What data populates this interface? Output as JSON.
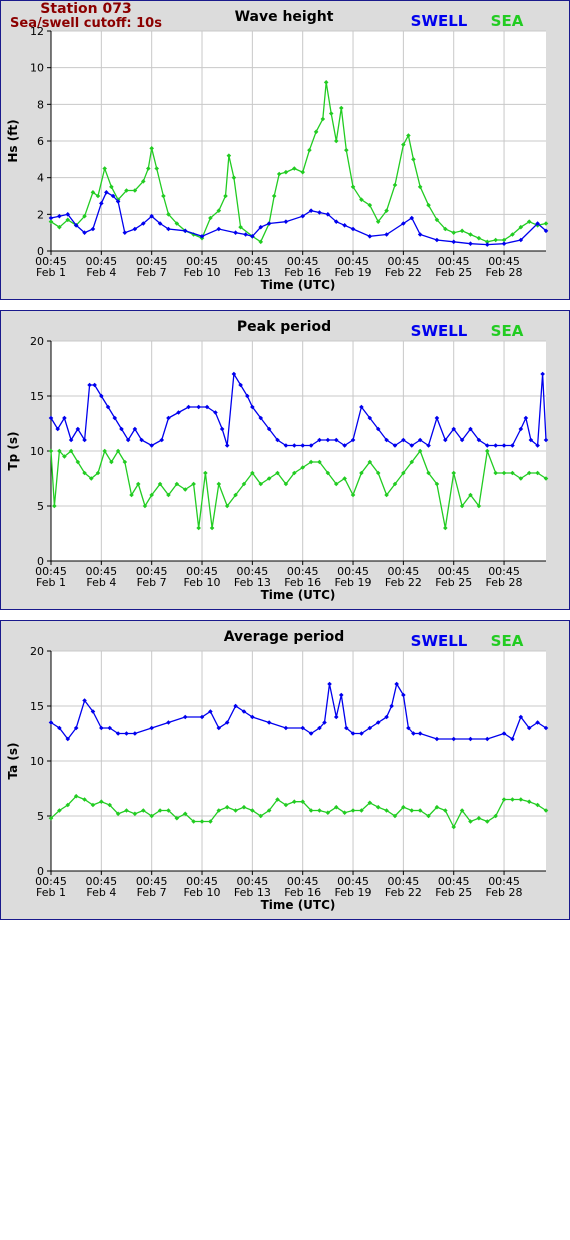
{
  "station": {
    "title": "Station 073",
    "cutoff": "Sea/swell cutoff: 10s"
  },
  "colors": {
    "swell": "#0000ee",
    "sea": "#22cc22",
    "frame": "#1a1a8c",
    "panel_bg": "#dcdcdc",
    "station": "#8b0000"
  },
  "chart_data": [
    {
      "type": "line",
      "title": "Wave height",
      "ylabel": "Hs (ft)",
      "xlabel": "Time (UTC)",
      "ylim": [
        0,
        12
      ],
      "yticks": [
        0,
        2,
        4,
        6,
        8,
        10,
        12
      ],
      "xlim": [
        1,
        30.5
      ],
      "xticks": [
        {
          "x": 1,
          "time": "00:45",
          "date": "Feb 1"
        },
        {
          "x": 4,
          "time": "00:45",
          "date": "Feb 4"
        },
        {
          "x": 7,
          "time": "00:45",
          "date": "Feb 7"
        },
        {
          "x": 10,
          "time": "00:45",
          "date": "Feb 10"
        },
        {
          "x": 13,
          "time": "00:45",
          "date": "Feb 13"
        },
        {
          "x": 16,
          "time": "00:45",
          "date": "Feb 16"
        },
        {
          "x": 19,
          "time": "00:45",
          "date": "Feb 19"
        },
        {
          "x": 22,
          "time": "00:45",
          "date": "Feb 22"
        },
        {
          "x": 25,
          "time": "00:45",
          "date": "Feb 25"
        },
        {
          "x": 28,
          "time": "00:45",
          "date": "Feb 28"
        }
      ],
      "grid": true,
      "legend": "top-right",
      "series": [
        {
          "name": "SWELL",
          "color": "#0000ee",
          "x": [
            1,
            1.5,
            2,
            2.5,
            3,
            3.5,
            4,
            4.3,
            4.7,
            5,
            5.4,
            6,
            6.5,
            7,
            7.5,
            8,
            9,
            10,
            11,
            12,
            12.6,
            13,
            13.5,
            14,
            15,
            16,
            16.5,
            17,
            17.5,
            18,
            18.5,
            19,
            20,
            21,
            22,
            22.5,
            23,
            24,
            25,
            26,
            27,
            28,
            29,
            30,
            30.5
          ],
          "y": [
            1.8,
            1.9,
            2.0,
            1.4,
            1.0,
            1.2,
            2.6,
            3.2,
            3.0,
            2.7,
            1.0,
            1.2,
            1.5,
            1.9,
            1.5,
            1.2,
            1.1,
            0.8,
            1.2,
            1.0,
            0.9,
            0.8,
            1.3,
            1.5,
            1.6,
            1.9,
            2.2,
            2.1,
            2.0,
            1.6,
            1.4,
            1.2,
            0.8,
            0.9,
            1.5,
            1.8,
            0.9,
            0.6,
            0.5,
            0.4,
            0.35,
            0.4,
            0.6,
            1.5,
            1.1
          ]
        },
        {
          "name": "SEA",
          "color": "#22cc22",
          "x": [
            1,
            1.5,
            2,
            2.5,
            3,
            3.5,
            3.8,
            4.2,
            4.6,
            5,
            5.5,
            6,
            6.5,
            6.8,
            7,
            7.3,
            7.7,
            8,
            8.5,
            9,
            9.5,
            10,
            10.5,
            11,
            11.4,
            11.6,
            11.9,
            12.3,
            13,
            13.5,
            14,
            14.3,
            14.6,
            15,
            15.5,
            16,
            16.4,
            16.8,
            17.2,
            17.4,
            17.7,
            18,
            18.3,
            18.6,
            19,
            19.5,
            20,
            20.5,
            21,
            21.5,
            22,
            22.3,
            22.6,
            23,
            23.5,
            24,
            24.5,
            25,
            25.5,
            26,
            26.5,
            27,
            27.5,
            28,
            28.5,
            29,
            29.5,
            30,
            30.5
          ],
          "y": [
            1.6,
            1.3,
            1.7,
            1.4,
            1.9,
            3.2,
            3.0,
            4.5,
            3.5,
            2.8,
            3.3,
            3.3,
            3.8,
            4.5,
            5.6,
            4.5,
            3.0,
            2.0,
            1.5,
            1.1,
            0.9,
            0.7,
            1.8,
            2.2,
            3.0,
            5.2,
            4.0,
            1.3,
            0.8,
            0.5,
            1.5,
            3.0,
            4.2,
            4.3,
            4.5,
            4.3,
            5.5,
            6.5,
            7.2,
            9.2,
            7.5,
            6.0,
            7.8,
            5.5,
            3.5,
            2.8,
            2.5,
            1.6,
            2.2,
            3.6,
            5.8,
            6.3,
            5.0,
            3.5,
            2.5,
            1.7,
            1.2,
            1.0,
            1.1,
            0.9,
            0.7,
            0.5,
            0.6,
            0.6,
            0.9,
            1.3,
            1.6,
            1.4,
            1.5
          ]
        }
      ]
    },
    {
      "type": "line",
      "title": "Peak period",
      "ylabel": "Tp (s)",
      "xlabel": "Time (UTC)",
      "ylim": [
        0,
        20
      ],
      "yticks": [
        0,
        5,
        10,
        15,
        20
      ],
      "xlim": [
        1,
        30.5
      ],
      "xticks": [
        {
          "x": 1,
          "time": "00:45",
          "date": "Feb 1"
        },
        {
          "x": 4,
          "time": "00:45",
          "date": "Feb 4"
        },
        {
          "x": 7,
          "time": "00:45",
          "date": "Feb 7"
        },
        {
          "x": 10,
          "time": "00:45",
          "date": "Feb 10"
        },
        {
          "x": 13,
          "time": "00:45",
          "date": "Feb 13"
        },
        {
          "x": 16,
          "time": "00:45",
          "date": "Feb 16"
        },
        {
          "x": 19,
          "time": "00:45",
          "date": "Feb 19"
        },
        {
          "x": 22,
          "time": "00:45",
          "date": "Feb 22"
        },
        {
          "x": 25,
          "time": "00:45",
          "date": "Feb 25"
        },
        {
          "x": 28,
          "time": "00:45",
          "date": "Feb 28"
        }
      ],
      "grid": true,
      "legend": "top-right",
      "series": [
        {
          "name": "SWELL",
          "color": "#0000ee",
          "x": [
            1,
            1.4,
            1.8,
            2.2,
            2.6,
            3.0,
            3.3,
            3.6,
            4.0,
            4.4,
            4.8,
            5.2,
            5.6,
            6.0,
            6.4,
            7.0,
            7.6,
            8.0,
            8.6,
            9.2,
            9.8,
            10.3,
            10.8,
            11.2,
            11.5,
            11.9,
            12.3,
            12.7,
            13.0,
            13.5,
            14.0,
            14.5,
            15.0,
            15.5,
            16.0,
            16.5,
            17.0,
            17.5,
            18.0,
            18.5,
            19.0,
            19.5,
            20.0,
            20.5,
            21.0,
            21.5,
            22.0,
            22.5,
            23.0,
            23.5,
            24.0,
            24.5,
            25.0,
            25.5,
            26.0,
            26.5,
            27.0,
            27.5,
            28.0,
            28.5,
            29.0,
            29.3,
            29.6,
            30.0,
            30.3,
            30.5
          ],
          "y": [
            13,
            12,
            13,
            11,
            12,
            11,
            16,
            16,
            15,
            14,
            13,
            12,
            11,
            12,
            11,
            10.5,
            11,
            13,
            13.5,
            14,
            14,
            14,
            13.5,
            12,
            10.5,
            17,
            16,
            15,
            14,
            13,
            12,
            11,
            10.5,
            10.5,
            10.5,
            10.5,
            11,
            11,
            11,
            10.5,
            11,
            14,
            13,
            12,
            11,
            10.5,
            11,
            10.5,
            11,
            10.5,
            13,
            11,
            12,
            11,
            12,
            11,
            10.5,
            10.5,
            10.5,
            10.5,
            12,
            13,
            11,
            10.5,
            17,
            11
          ]
        },
        {
          "name": "SEA",
          "color": "#22cc22",
          "x": [
            1,
            1.2,
            1.5,
            1.8,
            2.2,
            2.6,
            3.0,
            3.4,
            3.8,
            4.2,
            4.6,
            5.0,
            5.4,
            5.8,
            6.2,
            6.6,
            7.0,
            7.5,
            8.0,
            8.5,
            9.0,
            9.5,
            9.8,
            10.2,
            10.6,
            11.0,
            11.5,
            12.0,
            12.5,
            13.0,
            13.5,
            14.0,
            14.5,
            15.0,
            15.5,
            16.0,
            16.5,
            17.0,
            17.5,
            18.0,
            18.5,
            19.0,
            19.5,
            20.0,
            20.5,
            21.0,
            21.5,
            22.0,
            22.5,
            23.0,
            23.5,
            24.0,
            24.5,
            25.0,
            25.5,
            26.0,
            26.5,
            27.0,
            27.5,
            28.0,
            28.5,
            29.0,
            29.5,
            30.0,
            30.5
          ],
          "y": [
            10,
            5,
            10,
            9.5,
            10,
            9,
            8,
            7.5,
            8,
            10,
            9,
            10,
            9,
            6,
            7,
            5,
            6,
            7,
            6,
            7,
            6.5,
            7,
            3,
            8,
            3,
            7,
            5,
            6,
            7,
            8,
            7,
            7.5,
            8,
            7,
            8,
            8.5,
            9,
            9,
            8,
            7,
            7.5,
            6,
            8,
            9,
            8,
            6,
            7,
            8,
            9,
            10,
            8,
            7,
            3,
            8,
            5,
            6,
            5,
            10,
            8,
            8,
            8,
            7.5,
            8,
            8,
            7.5
          ]
        }
      ]
    },
    {
      "type": "line",
      "title": "Average period",
      "ylabel": "Ta (s)",
      "xlabel": "Time (UTC)",
      "ylim": [
        0,
        20
      ],
      "yticks": [
        0,
        5,
        10,
        15,
        20
      ],
      "xlim": [
        1,
        30.5
      ],
      "xticks": [
        {
          "x": 1,
          "time": "00:45",
          "date": "Feb 1"
        },
        {
          "x": 4,
          "time": "00:45",
          "date": "Feb 4"
        },
        {
          "x": 7,
          "time": "00:45",
          "date": "Feb 7"
        },
        {
          "x": 10,
          "time": "00:45",
          "date": "Feb 10"
        },
        {
          "x": 13,
          "time": "00:45",
          "date": "Feb 13"
        },
        {
          "x": 16,
          "time": "00:45",
          "date": "Feb 16"
        },
        {
          "x": 19,
          "time": "00:45",
          "date": "Feb 19"
        },
        {
          "x": 22,
          "time": "00:45",
          "date": "Feb 22"
        },
        {
          "x": 25,
          "time": "00:45",
          "date": "Feb 25"
        },
        {
          "x": 28,
          "time": "00:45",
          "date": "Feb 28"
        }
      ],
      "grid": true,
      "legend": "top-right",
      "series": [
        {
          "name": "SWELL",
          "color": "#0000ee",
          "x": [
            1,
            1.5,
            2,
            2.5,
            3,
            3.5,
            4,
            4.5,
            5,
            5.5,
            6,
            7,
            8,
            9,
            10,
            10.5,
            11,
            11.5,
            12,
            12.5,
            13,
            14,
            15,
            16,
            16.5,
            17,
            17.3,
            17.6,
            18,
            18.3,
            18.6,
            19,
            19.5,
            20,
            20.5,
            21,
            21.3,
            21.6,
            22,
            22.3,
            22.6,
            23,
            24,
            25,
            26,
            27,
            28,
            28.5,
            29,
            29.5,
            30,
            30.5
          ],
          "y": [
            13.5,
            13,
            12,
            13,
            15.5,
            14.5,
            13,
            13,
            12.5,
            12.5,
            12.5,
            13,
            13.5,
            14,
            14,
            14.5,
            13,
            13.5,
            15,
            14.5,
            14,
            13.5,
            13,
            13,
            12.5,
            13,
            13.5,
            17,
            14,
            16,
            13,
            12.5,
            12.5,
            13,
            13.5,
            14,
            15,
            17,
            16,
            13,
            12.5,
            12.5,
            12,
            12,
            12,
            12,
            12.5,
            12,
            14,
            13,
            13.5,
            13
          ]
        },
        {
          "name": "SEA",
          "color": "#22cc22",
          "x": [
            1,
            1.5,
            2,
            2.5,
            3,
            3.5,
            4,
            4.5,
            5,
            5.5,
            6,
            6.5,
            7,
            7.5,
            8,
            8.5,
            9,
            9.5,
            10,
            10.5,
            11,
            11.5,
            12,
            12.5,
            13,
            13.5,
            14,
            14.5,
            15,
            15.5,
            16,
            16.5,
            17,
            17.5,
            18,
            18.5,
            19,
            19.5,
            20,
            20.5,
            21,
            21.5,
            22,
            22.5,
            23,
            23.5,
            24,
            24.5,
            25,
            25.5,
            26,
            26.5,
            27,
            27.5,
            28,
            28.5,
            29,
            29.5,
            30,
            30.5
          ],
          "y": [
            4.8,
            5.5,
            6.0,
            6.8,
            6.5,
            6.0,
            6.3,
            6.0,
            5.2,
            5.5,
            5.2,
            5.5,
            5.0,
            5.5,
            5.5,
            4.8,
            5.2,
            4.5,
            4.5,
            4.5,
            5.5,
            5.8,
            5.5,
            5.8,
            5.5,
            5.0,
            5.5,
            6.5,
            6.0,
            6.3,
            6.3,
            5.5,
            5.5,
            5.3,
            5.8,
            5.3,
            5.5,
            5.5,
            6.2,
            5.8,
            5.5,
            5.0,
            5.8,
            5.5,
            5.5,
            5.0,
            5.8,
            5.5,
            4.0,
            5.5,
            4.5,
            4.8,
            4.5,
            5.0,
            6.5,
            6.5,
            6.5,
            6.3,
            6.0,
            5.5
          ]
        }
      ]
    }
  ]
}
